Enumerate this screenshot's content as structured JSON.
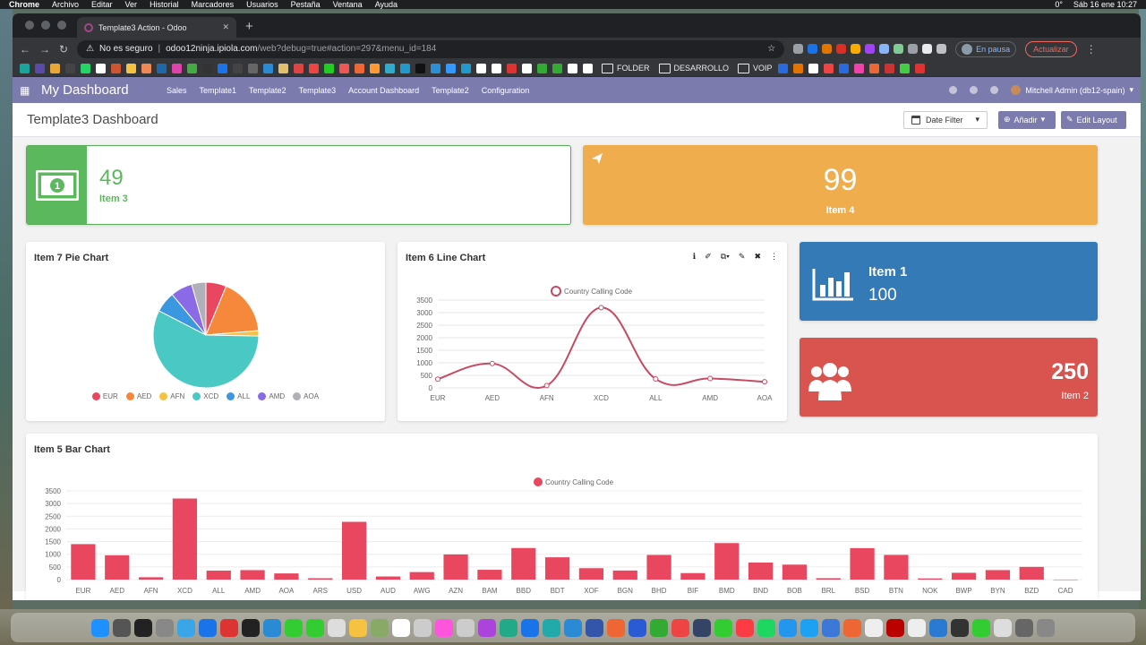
{
  "menubar": {
    "app": "Chrome",
    "items": [
      "Archivo",
      "Editar",
      "Ver",
      "Historial",
      "Marcadores",
      "Usuarios",
      "Pestaña",
      "Ventana",
      "Ayuda"
    ],
    "status_temp": "0°",
    "clock": "Sáb 16 ene  10:27"
  },
  "browser": {
    "tab_title": "Template3 Action - Odoo",
    "security_label": "No es seguro",
    "url_host": "odoo12ninja.ipiola.com",
    "url_path": "/web?debug=true#action=297&menu_id=184",
    "profile_label": "En pausa",
    "update_label": "Actualizar",
    "bookmarks": [
      "FOLDER",
      "DESARROLLO",
      "VOIP"
    ]
  },
  "odoo": {
    "brand": "My Dashboard",
    "menu": [
      "Sales",
      "Template1",
      "Template2",
      "Template3",
      "Account Dashboard",
      "Template2",
      "Configuration"
    ],
    "user": "Mitchell Admin (db12-spain)",
    "page_title": "Template3 Dashboard",
    "date_filter": "Date Filter",
    "add_label": "Añadir",
    "edit_layout": "Edit Layout"
  },
  "tiles": {
    "item3": {
      "value": "49",
      "label": "Item 3",
      "color": "#5cb85c"
    },
    "item4": {
      "value": "99",
      "label": "Item 4",
      "color": "#f0ad4e"
    },
    "item1": {
      "value": "100",
      "label": "Item 1",
      "color": "#337ab7"
    },
    "item2": {
      "value": "250",
      "label": "Item 2",
      "color": "#d9534f"
    }
  },
  "chart_data": [
    {
      "type": "pie",
      "title": "Item 7 Pie Chart",
      "categories": [
        "EUR",
        "AED",
        "AFN",
        "XCD",
        "ALL",
        "AMD",
        "AOA"
      ],
      "values": [
        350,
        971,
        93,
        3200,
        355,
        374,
        244
      ],
      "colors": [
        "#e8475f",
        "#f5883a",
        "#f5c242",
        "#4ac8c4",
        "#3a97e0",
        "#8b6ae8",
        "#b0b0b8"
      ],
      "legend": "bottom"
    },
    {
      "type": "line",
      "title": "Item 6 Line Chart",
      "categories": [
        "EUR",
        "AED",
        "AFN",
        "XCD",
        "ALL",
        "AMD",
        "AOA"
      ],
      "series": [
        {
          "name": "Country Calling Code",
          "values": [
            350,
            971,
            93,
            3200,
            355,
            374,
            244
          ],
          "color": "#c74a63"
        }
      ],
      "ylim": [
        0,
        3500
      ],
      "yticks": [
        0,
        500,
        1000,
        1500,
        2000,
        2500,
        3000,
        3500
      ],
      "legend": "top"
    },
    {
      "type": "bar",
      "title": "Item 5 Bar Chart",
      "categories": [
        "EUR",
        "AED",
        "AFN",
        "XCD",
        "ALL",
        "AMD",
        "AOA",
        "ARS",
        "USD",
        "AUD",
        "AWG",
        "AZN",
        "BAM",
        "BBD",
        "BDT",
        "XOF",
        "BGN",
        "BHD",
        "BIF",
        "BMD",
        "BND",
        "BOB",
        "BRL",
        "BSD",
        "BTN",
        "NOK",
        "BWP",
        "BYN",
        "BZD",
        "CAD"
      ],
      "series": [
        {
          "name": "Country Calling Code",
          "values": [
            1400,
            960,
            93,
            3200,
            355,
            374,
            244,
            54,
            2280,
            123,
            297,
            994,
            387,
            1246,
            880,
            450,
            359,
            973,
            257,
            1441,
            673,
            591,
            55,
            1242,
            975,
            47,
            267,
            375,
            501,
            1
          ],
          "color": "#e8475f"
        }
      ],
      "ylim": [
        0,
        3500
      ],
      "yticks": [
        0,
        500,
        1000,
        1500,
        2000,
        2500,
        3000,
        3500
      ],
      "legend": "top"
    }
  ]
}
